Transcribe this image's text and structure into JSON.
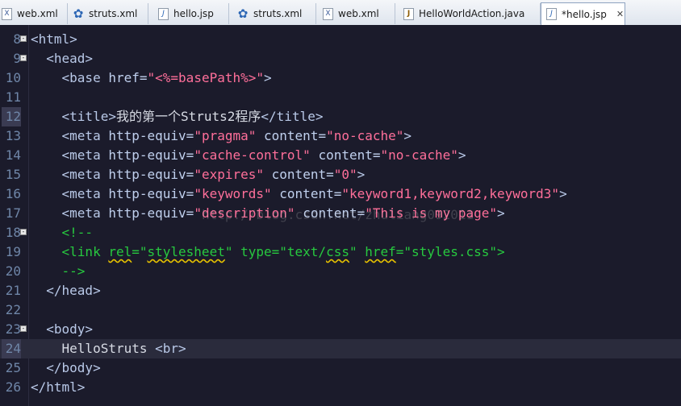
{
  "tabs": [
    {
      "label": "web.xml",
      "icon": "xml-file-icon"
    },
    {
      "label": "struts.xml",
      "icon": "struts-config-icon"
    },
    {
      "label": "hello.jsp",
      "icon": "jsp-file-icon"
    },
    {
      "label": "struts.xml",
      "icon": "struts-config-icon"
    },
    {
      "label": "web.xml",
      "icon": "xml-file-icon"
    },
    {
      "label": "HelloWorldAction.java",
      "icon": "java-file-icon"
    },
    {
      "label": "*hello.jsp",
      "icon": "jsp-file-icon",
      "active": true
    }
  ],
  "gutter": {
    "line_numbers": [
      "8",
      "9",
      "10",
      "11",
      "12",
      "13",
      "14",
      "15",
      "16",
      "17",
      "18",
      "19",
      "20",
      "21",
      "22",
      "23",
      "24",
      "25",
      "26"
    ]
  },
  "code": {
    "l8": {
      "t1": "<html>"
    },
    "l9": {
      "t1": "<head>"
    },
    "l10": {
      "t1": "<base",
      "a1": "href=",
      "v1": "\"<%=basePath%>\"",
      "t2": ">"
    },
    "l12": {
      "t1": "<title>",
      "x1": "我的第一个Struts2程序",
      "t2": "</title>"
    },
    "l13": {
      "t1": "<meta",
      "a1": "http-equiv=",
      "v1": "\"pragma\"",
      "a2": "content=",
      "v2": "\"no-cache\"",
      "t2": ">"
    },
    "l14": {
      "t1": "<meta",
      "a1": "http-equiv=",
      "v1": "\"cache-control\"",
      "a2": "content=",
      "v2": "\"no-cache\"",
      "t2": ">"
    },
    "l15": {
      "t1": "<meta",
      "a1": "http-equiv=",
      "v1": "\"expires\"",
      "a2": "content=",
      "v2": "\"0\"",
      "t2": ">"
    },
    "l16": {
      "t1": "<meta",
      "a1": "http-equiv=",
      "v1": "\"keywords\"",
      "a2": "content=",
      "v2": "\"keyword1,keyword2,keyword3\"",
      "t2": ">"
    },
    "l17": {
      "t1": "<meta",
      "a1": "http-equiv=",
      "v1": "\"description\"",
      "a2": "content=",
      "v2": "\"This is my page\"",
      "t2": ">"
    },
    "l18": {
      "c1": "<!--"
    },
    "l19": {
      "c1": "<link ",
      "c2": "rel",
      "c3": "=\"",
      "c4": "stylesheet",
      "c5": "\" type=\"text/",
      "c6": "css",
      "c7": "\" ",
      "c8": "href",
      "c9": "=\"styles.css\">"
    },
    "l20": {
      "c1": "-->"
    },
    "l21": {
      "t1": "</head>"
    },
    "l23": {
      "t1": "<body>"
    },
    "l24": {
      "x1": "HelloStruts",
      "t1": "<br>"
    },
    "l25": {
      "t1": "</body>"
    },
    "l26": {
      "t1": "</html>"
    }
  },
  "watermark": "http://blog.csdn.net/zhuliang092011",
  "colors": {
    "editor_bg": "#1b1b2b",
    "tag": "#b9c9e8",
    "string": "#ff6f9a",
    "comment": "#27c93f",
    "line_number": "#6f86a8"
  }
}
